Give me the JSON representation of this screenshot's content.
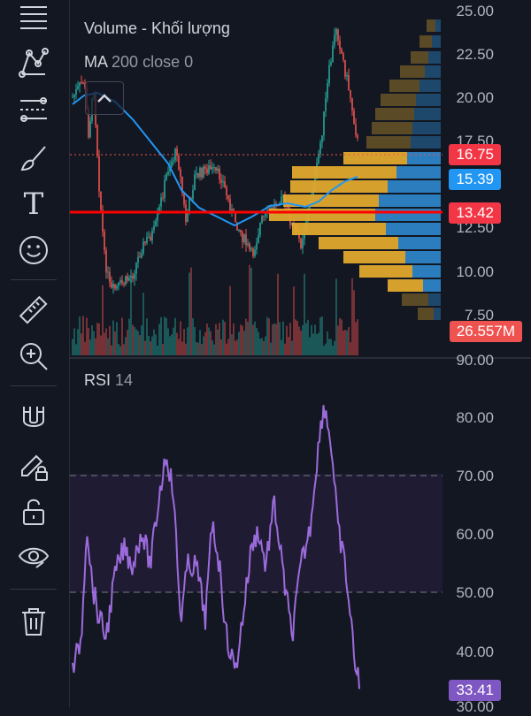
{
  "toolbar": {
    "tools": [
      {
        "icon": "crosshair-lines-icon"
      },
      {
        "icon": "pattern-icon"
      },
      {
        "icon": "fib-lines-icon"
      },
      {
        "icon": "brush-icon"
      },
      {
        "icon": "text-icon",
        "glyph": "T"
      },
      {
        "icon": "emoji-icon"
      },
      {
        "icon": "ruler-icon"
      },
      {
        "icon": "zoom-in-icon"
      },
      {
        "icon": "magnet-icon"
      },
      {
        "icon": "lock-drawing-icon"
      },
      {
        "icon": "unlock-icon"
      },
      {
        "icon": "eye-icon"
      },
      {
        "icon": "trash-icon"
      }
    ]
  },
  "main_pane": {
    "legend_volume": "Volume - Khối lượng",
    "legend_ma_name": "MA",
    "legend_ma_params": "200 close 0",
    "price_axis": [
      "25.00",
      "22.50",
      "20.00",
      "17.50",
      "12.50",
      "10.00",
      "7.50"
    ],
    "tags": {
      "last_price": "16.75",
      "ma_value": "15.39",
      "line_price": "13.42",
      "volume": "26.557M"
    },
    "colors": {
      "up": "#26a69a",
      "down": "#ef5350",
      "ma": "#2196f3",
      "horizontal_line": "#ff0000",
      "vp_up": "#e0a82e",
      "vp_down": "#2d83c7"
    }
  },
  "rsi_pane": {
    "legend_name": "RSI",
    "legend_period": "14",
    "axis": [
      "90.00",
      "80.00",
      "70.00",
      "60.00",
      "50.00",
      "40.00",
      "30.00"
    ],
    "current_value": "33.41",
    "colors": {
      "line": "#9c6bdb",
      "band": "#1f1b33"
    }
  }
}
